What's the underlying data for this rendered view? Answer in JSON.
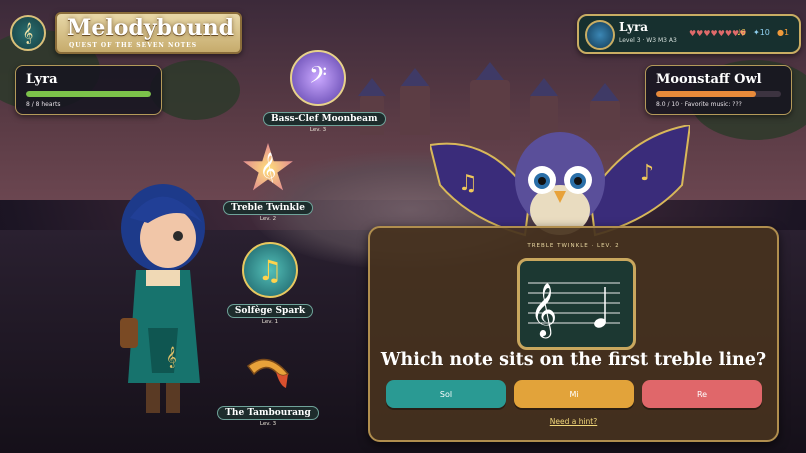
{
  "game": {
    "title": "Melodybound",
    "subtitle": "QUEST OF THE SEVEN NOTES",
    "logo_icon": "treble-clef-icon"
  },
  "player_hud": {
    "name": "Lyra",
    "level_text": "Level 3 · W3 M3 A3",
    "hearts_text": "♥♥♥♥♥♥♥♥",
    "notes_stat": "♩6",
    "stars_stat": "✦10",
    "coins_stat": "●1"
  },
  "player_panel": {
    "name": "Lyra",
    "hearts_text": "8 / 8 hearts",
    "hp_fraction": 1.0,
    "bar_color": "#7cc24a"
  },
  "enemy_panel": {
    "name": "Moonstaff Owl",
    "status_text": "8.0 / 10 · Favorite music: ???",
    "hp_fraction": 0.8,
    "bar_color": "#e88a3a"
  },
  "creatures": [
    {
      "name": "Bass-Clef Moonbeam",
      "level": "Lev. 3",
      "icon": "bass-clef-moon-icon"
    },
    {
      "name": "Treble Twinkle",
      "level": "Lev. 2",
      "icon": "treble-star-icon"
    },
    {
      "name": "Solfège Spark",
      "level": "Lev. 1",
      "icon": "music-notes-icon"
    },
    {
      "name": "The Tambourang",
      "level": "Lev. 3",
      "icon": "boomerang-icon"
    }
  ],
  "question_card": {
    "header": "TREBLE TWINKLE · LEV. 2",
    "question": "Which note sits on the first treble line?",
    "answers": [
      {
        "label": "Sol",
        "color": "#2a9a93"
      },
      {
        "label": "Mi",
        "color": "#e2a33a"
      },
      {
        "label": "Re",
        "color": "#e0676a"
      }
    ],
    "hint_label": "Need a hint?"
  }
}
